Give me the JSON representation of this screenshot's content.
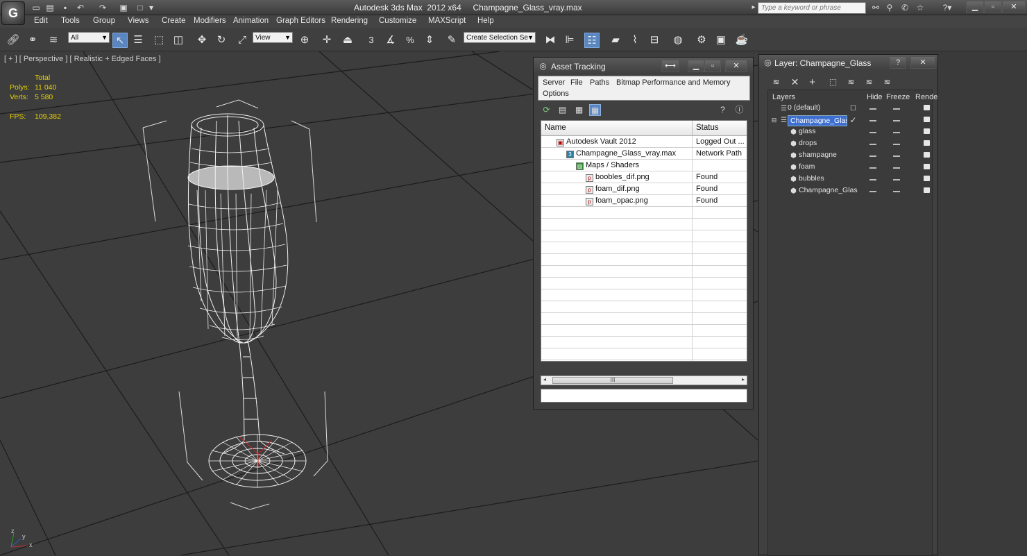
{
  "window": {
    "app_title": "Autodesk 3ds Max  2012 x64",
    "file_title": "Champagne_Glass_vray.max",
    "search_placeholder": "Type a keyword or phrase"
  },
  "menu": [
    "Edit",
    "Tools",
    "Group",
    "Views",
    "Create",
    "Modifiers",
    "Animation",
    "Graph Editors",
    "Rendering",
    "Customize",
    "MAXScript",
    "Help"
  ],
  "toolbar": {
    "filter_value": "All",
    "ref_coord_value": "View",
    "snap_label": "3",
    "selection_set_placeholder": "Create Selection Se"
  },
  "viewport": {
    "label": "[ + ] [ Perspective ] [ Realistic + Edged Faces ]",
    "stats": {
      "total_label": "Total",
      "polys_label": "Polys:",
      "polys_value": "11 040",
      "verts_label": "Verts:",
      "verts_value": "5 580",
      "fps_label": "FPS:",
      "fps_value": "109,382"
    },
    "axis": {
      "x": "x",
      "y": "y",
      "z": "z"
    }
  },
  "asset_tracking": {
    "title": "Asset Tracking",
    "menu": [
      "Server",
      "File",
      "Paths",
      "Bitmap Performance and Memory",
      "Options"
    ],
    "columns": [
      "Name",
      "Status"
    ],
    "rows": [
      {
        "name": "Autodesk Vault 2012",
        "status": "Logged Out ..."
      },
      {
        "name": "Champagne_Glass_vray.max",
        "status": "Network Path"
      },
      {
        "name": "Maps / Shaders",
        "status": ""
      },
      {
        "name": "boobles_dif.png",
        "status": "Found"
      },
      {
        "name": "foam_dif.png",
        "status": "Found"
      },
      {
        "name": "foam_opac.png",
        "status": "Found"
      }
    ],
    "scroll_grip": "III"
  },
  "layer_manager": {
    "title": "Layer: Champagne_Glass",
    "columns": [
      "Layers",
      "Hide",
      "Freeze",
      "Rende"
    ],
    "layers": [
      {
        "name": "0 (default)"
      },
      {
        "name": "Champagne_Glass"
      },
      {
        "name": "glass"
      },
      {
        "name": "drops"
      },
      {
        "name": "shampagne"
      },
      {
        "name": "foam"
      },
      {
        "name": "bubbles"
      },
      {
        "name": "Champagne_Glas"
      }
    ]
  }
}
